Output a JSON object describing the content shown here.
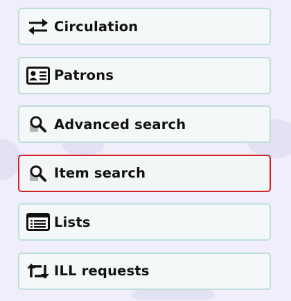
{
  "menu": {
    "items": [
      {
        "label": "Circulation",
        "icon": "circulation-arrows-icon",
        "active": false
      },
      {
        "label": "Patrons",
        "icon": "patron-card-icon",
        "active": false
      },
      {
        "label": "Advanced search",
        "icon": "magnifier-icon",
        "active": false
      },
      {
        "label": "Item search",
        "icon": "magnifier-icon",
        "active": true
      },
      {
        "label": "Lists",
        "icon": "list-icon",
        "active": false
      },
      {
        "label": "ILL requests",
        "icon": "retweet-arrows-icon",
        "active": false
      }
    ]
  },
  "colors": {
    "page_background": "#f1eefb",
    "item_background": "#f4f8f9",
    "item_border": "#bfdedb",
    "active_border": "#d2232a",
    "text": "#111111"
  }
}
